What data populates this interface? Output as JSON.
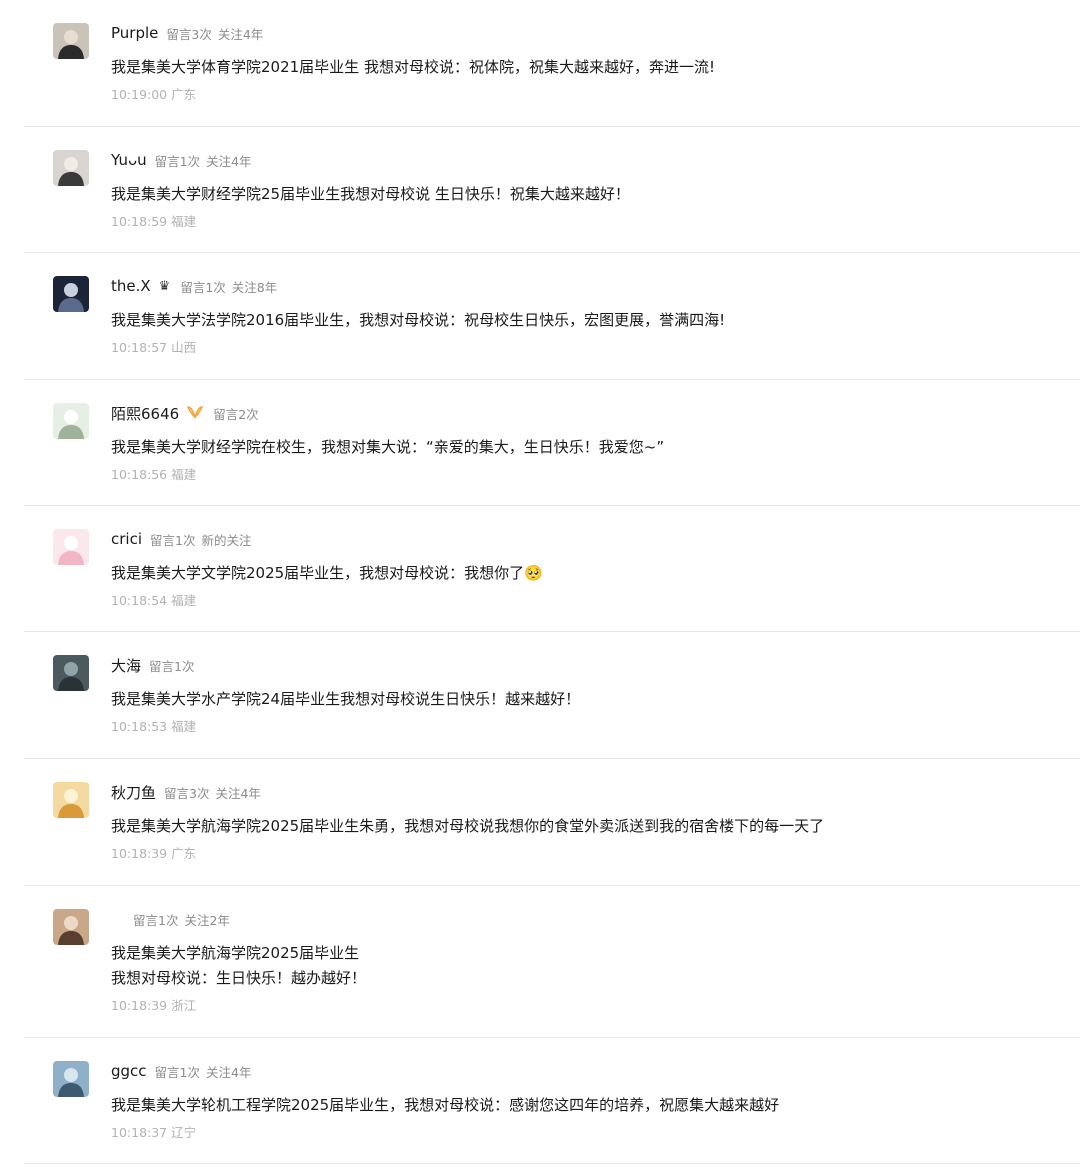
{
  "comments": [
    {
      "nickname": "Purple",
      "badge": "",
      "stats": [
        "留言3次",
        "关注4年"
      ],
      "content": [
        "我是集美大学体育学院2021届毕业生 我想对母校说：祝体院，祝集大越来越好，奔进一流!"
      ],
      "time": "10:19:00",
      "location": "广东",
      "avatar_colors": [
        "#c9c3b8",
        "#2b2b2b",
        "#e8ddd0"
      ]
    },
    {
      "nickname": "Yuᴗu",
      "badge": "",
      "stats": [
        "留言1次",
        "关注4年"
      ],
      "content": [
        "我是集美大学财经学院25届毕业生我想对母校说 生日快乐！祝集大越来越好！"
      ],
      "time": "10:18:59",
      "location": "福建",
      "avatar_colors": [
        "#d8d4d0",
        "#3a3a3a",
        "#f0ece8"
      ]
    },
    {
      "nickname": "the.X",
      "badge": "♛",
      "stats": [
        "留言1次",
        "关注8年"
      ],
      "content": [
        "我是集美大学法学院2016届毕业生，我想对母校说：祝母校生日快乐，宏图更展，誉满四海!"
      ],
      "time": "10:18:57",
      "location": "山西",
      "avatar_colors": [
        "#1c2538",
        "#5a6a8a",
        "#c8d0e0"
      ]
    },
    {
      "nickname": "陌熙6646",
      "badge": "",
      "stats": [
        "留言2次"
      ],
      "content": [
        "我是集美大学财经学院在校生，我想对集大说：“亲爱的集大，生日快乐！我爱您~”"
      ],
      "time": "10:18:56",
      "location": "福建",
      "avatar_colors": [
        "#e6efe4",
        "#9fb39a",
        "#ffffff"
      ]
    },
    {
      "nickname": "crici",
      "badge": "",
      "stats": [
        "留言1次",
        "新的关注"
      ],
      "content": [
        "我是集美大学文学院2025届毕业生，我想对母校说：我想你了🥺"
      ],
      "time": "10:18:54",
      "location": "福建",
      "avatar_colors": [
        "#fbe8ec",
        "#f2b5c3",
        "#ffffff"
      ]
    },
    {
      "nickname": "大海",
      "badge": "",
      "stats": [
        "留言1次"
      ],
      "content": [
        "我是集美大学水产学院24届毕业生我想对母校说生日快乐！越来越好！"
      ],
      "time": "10:18:53",
      "location": "福建",
      "avatar_colors": [
        "#4a5a5e",
        "#2a3236",
        "#8fa3a8"
      ]
    },
    {
      "nickname": "秋刀鱼",
      "badge": "",
      "stats": [
        "留言3次",
        "关注4年"
      ],
      "content": [
        "我是集美大学航海学院2025届毕业生朱勇，我想对母校说我想你的食堂外卖派送到我的宿舍楼下的每一天了"
      ],
      "time": "10:18:39",
      "location": "广东",
      "avatar_colors": [
        "#f4d9a0",
        "#d99a3a",
        "#fff3d6"
      ]
    },
    {
      "nickname": "",
      "badge": "",
      "stats": [
        "留言1次",
        "关注2年"
      ],
      "content": [
        "我是集美大学航海学院2025届毕业生",
        "我想对母校说：生日快乐！越办越好！"
      ],
      "time": "10:18:39",
      "location": "浙江",
      "avatar_colors": [
        "#c9a88a",
        "#5a3e2e",
        "#ecd9c6"
      ]
    },
    {
      "nickname": "ggcc",
      "badge": "",
      "stats": [
        "留言1次",
        "关注4年"
      ],
      "content": [
        "我是集美大学轮机工程学院2025届毕业生，我想对母校说：感谢您这四年的培养，祝愿集大越来越好"
      ],
      "time": "10:18:37",
      "location": "辽宁",
      "avatar_colors": [
        "#8fb0c8",
        "#3d5a70",
        "#d8e6ee"
      ]
    }
  ]
}
